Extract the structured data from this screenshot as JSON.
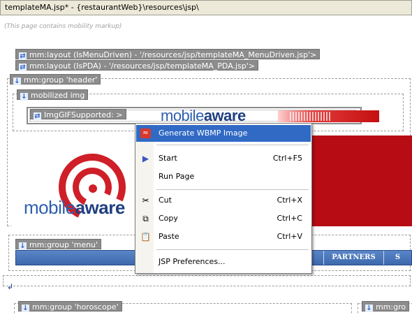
{
  "window": {
    "title": "templateMA.jsp* - {restaurantWeb}\\resources\\jsp\\"
  },
  "page": {
    "notice": "(This page contains mobility markup)",
    "tags": {
      "layout_menu": "mm:layout (IsMenuDriven) - '/resources/jsp/templateMA_MenuDriven.jsp'>",
      "layout_pda": "mm:layout (IsPDA) - '/resources/jsp/templateMA_PDA.jsp'>",
      "group_header": "mm:group 'header'",
      "mobilized_img": "mobilized img",
      "img_gif": "ImgGIFSupported: >",
      "group_menu": "mm:group 'menu'",
      "group_horoscope": "mm:group 'horoscope'",
      "group_right": "mm:gro"
    },
    "logo": {
      "part1": "mobile",
      "part2": "aware"
    },
    "hero_logo": {
      "part1": "mobile",
      "part2": "aware"
    },
    "nav": [
      "PARTNERS",
      "S"
    ]
  },
  "context_menu": {
    "items": [
      {
        "label": "Generate WBMP Image",
        "shortcut": "",
        "icon": "wbmp-icon",
        "highlighted": true
      },
      {
        "label": "Start",
        "shortcut": "Ctrl+F5",
        "icon": "play-icon"
      },
      {
        "label": "Run Page",
        "shortcut": "",
        "icon": ""
      },
      {
        "label": "Cut",
        "shortcut": "Ctrl+X",
        "icon": "scissors-icon"
      },
      {
        "label": "Copy",
        "shortcut": "Ctrl+C",
        "icon": "copy-icon"
      },
      {
        "label": "Paste",
        "shortcut": "Ctrl+V",
        "icon": "paste-icon"
      },
      {
        "label": "JSP Preferences...",
        "shortcut": "",
        "icon": ""
      }
    ]
  },
  "colors": {
    "tag_bg": "#8c8c8c",
    "menu_highlight": "#316ac5",
    "brand_red": "#b80c14",
    "brand_blue": "#2e5fb0"
  }
}
